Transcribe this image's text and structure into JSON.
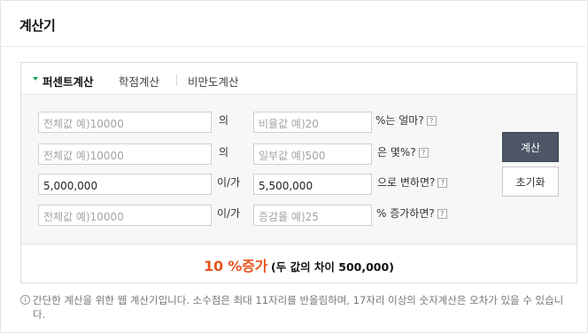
{
  "title": "계산기",
  "tabs": [
    {
      "label": "퍼센트계산",
      "active": true
    },
    {
      "label": "학점계산",
      "active": false
    },
    {
      "label": "비만도계산",
      "active": false
    }
  ],
  "rows": [
    {
      "input1": {
        "value": "",
        "placeholder": "전체값 예)10000"
      },
      "connector": "의",
      "input2": {
        "value": "",
        "placeholder": "비율값 예)20"
      },
      "suffix": "%는 얼마?"
    },
    {
      "input1": {
        "value": "",
        "placeholder": "전체값 예)10000"
      },
      "connector": "의",
      "input2": {
        "value": "",
        "placeholder": "일부값 예)500"
      },
      "suffix": "은 몇%?"
    },
    {
      "input1": {
        "value": "5,000,000",
        "placeholder": ""
      },
      "connector": "이/가",
      "input2": {
        "value": "5,500,000",
        "placeholder": ""
      },
      "suffix": "으로 변하면?"
    },
    {
      "input1": {
        "value": "",
        "placeholder": "전체값 예)10000"
      },
      "connector": "이/가",
      "input2": {
        "value": "",
        "placeholder": "증감율 예)25"
      },
      "suffix": "% 증가하면?"
    }
  ],
  "help_glyph": "?",
  "buttons": {
    "calculate": "계산",
    "reset": "초기화"
  },
  "result": {
    "main": "10 %증가",
    "sub": "(두 값의 차이 500,000)"
  },
  "notice": {
    "icon": "i",
    "text": "간단한 계산을 위한 웹 계산기입니다. 소수점은 최대 11자리를 반올림하며, 17자리 이상의 숫자계산은 오차가 있을 수 있습니다."
  },
  "colors": {
    "tab_arrow": "#1aa35a",
    "result_highlight": "#e8541e",
    "calc_button": "#4d5566"
  }
}
